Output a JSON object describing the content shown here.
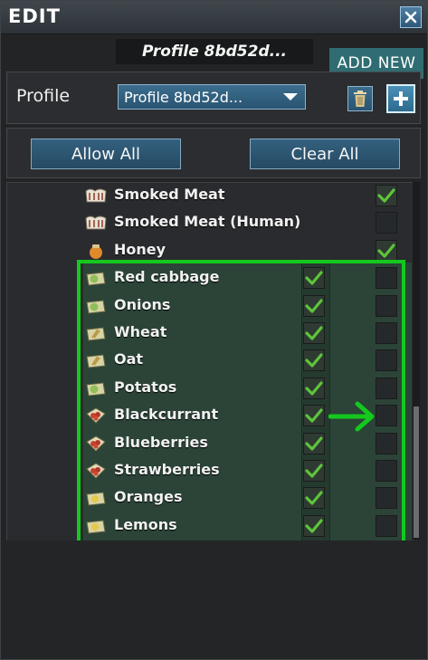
{
  "window": {
    "title": "EDIT",
    "close_icon": "close-icon",
    "header_profile_name": "Profile 8bd52d...",
    "tooltip_add_new": "ADD NEW"
  },
  "profile": {
    "label": "Profile",
    "selected": "Profile 8bd52d...",
    "delete_icon": "trash-icon",
    "add_icon": "plus-icon"
  },
  "actions": {
    "allow_all": "Allow All",
    "clear_all": "Clear All"
  },
  "items": [
    {
      "label": "Smoked Meat",
      "icon": "meat-icon",
      "left_checked": null,
      "right_checked": true
    },
    {
      "label": "Smoked Meat (Human)",
      "icon": "meat-icon",
      "left_checked": null,
      "right_checked": false
    },
    {
      "label": "Honey",
      "icon": "honey-icon",
      "left_checked": null,
      "right_checked": true
    },
    {
      "label": "Red cabbage",
      "icon": "vegetable-icon",
      "left_checked": true,
      "right_checked": false
    },
    {
      "label": "Onions",
      "icon": "vegetable-icon",
      "left_checked": true,
      "right_checked": false
    },
    {
      "label": "Wheat",
      "icon": "grain-icon",
      "left_checked": true,
      "right_checked": false
    },
    {
      "label": "Oat",
      "icon": "grain-icon",
      "left_checked": true,
      "right_checked": false
    },
    {
      "label": "Potatos",
      "icon": "vegetable-icon",
      "left_checked": true,
      "right_checked": false
    },
    {
      "label": "Blackcurrant",
      "icon": "berries-icon",
      "left_checked": true,
      "right_checked": false
    },
    {
      "label": "Blueberries",
      "icon": "berries-icon",
      "left_checked": true,
      "right_checked": false
    },
    {
      "label": "Strawberries",
      "icon": "berries-icon",
      "left_checked": true,
      "right_checked": false
    },
    {
      "label": "Oranges",
      "icon": "fruit-icon",
      "left_checked": true,
      "right_checked": false
    },
    {
      "label": "Lemons",
      "icon": "fruit-icon",
      "left_checked": true,
      "right_checked": false
    }
  ],
  "colors": {
    "highlight": "#14c81e",
    "check": "#5ec43a",
    "button_blue": "#2f5878"
  }
}
